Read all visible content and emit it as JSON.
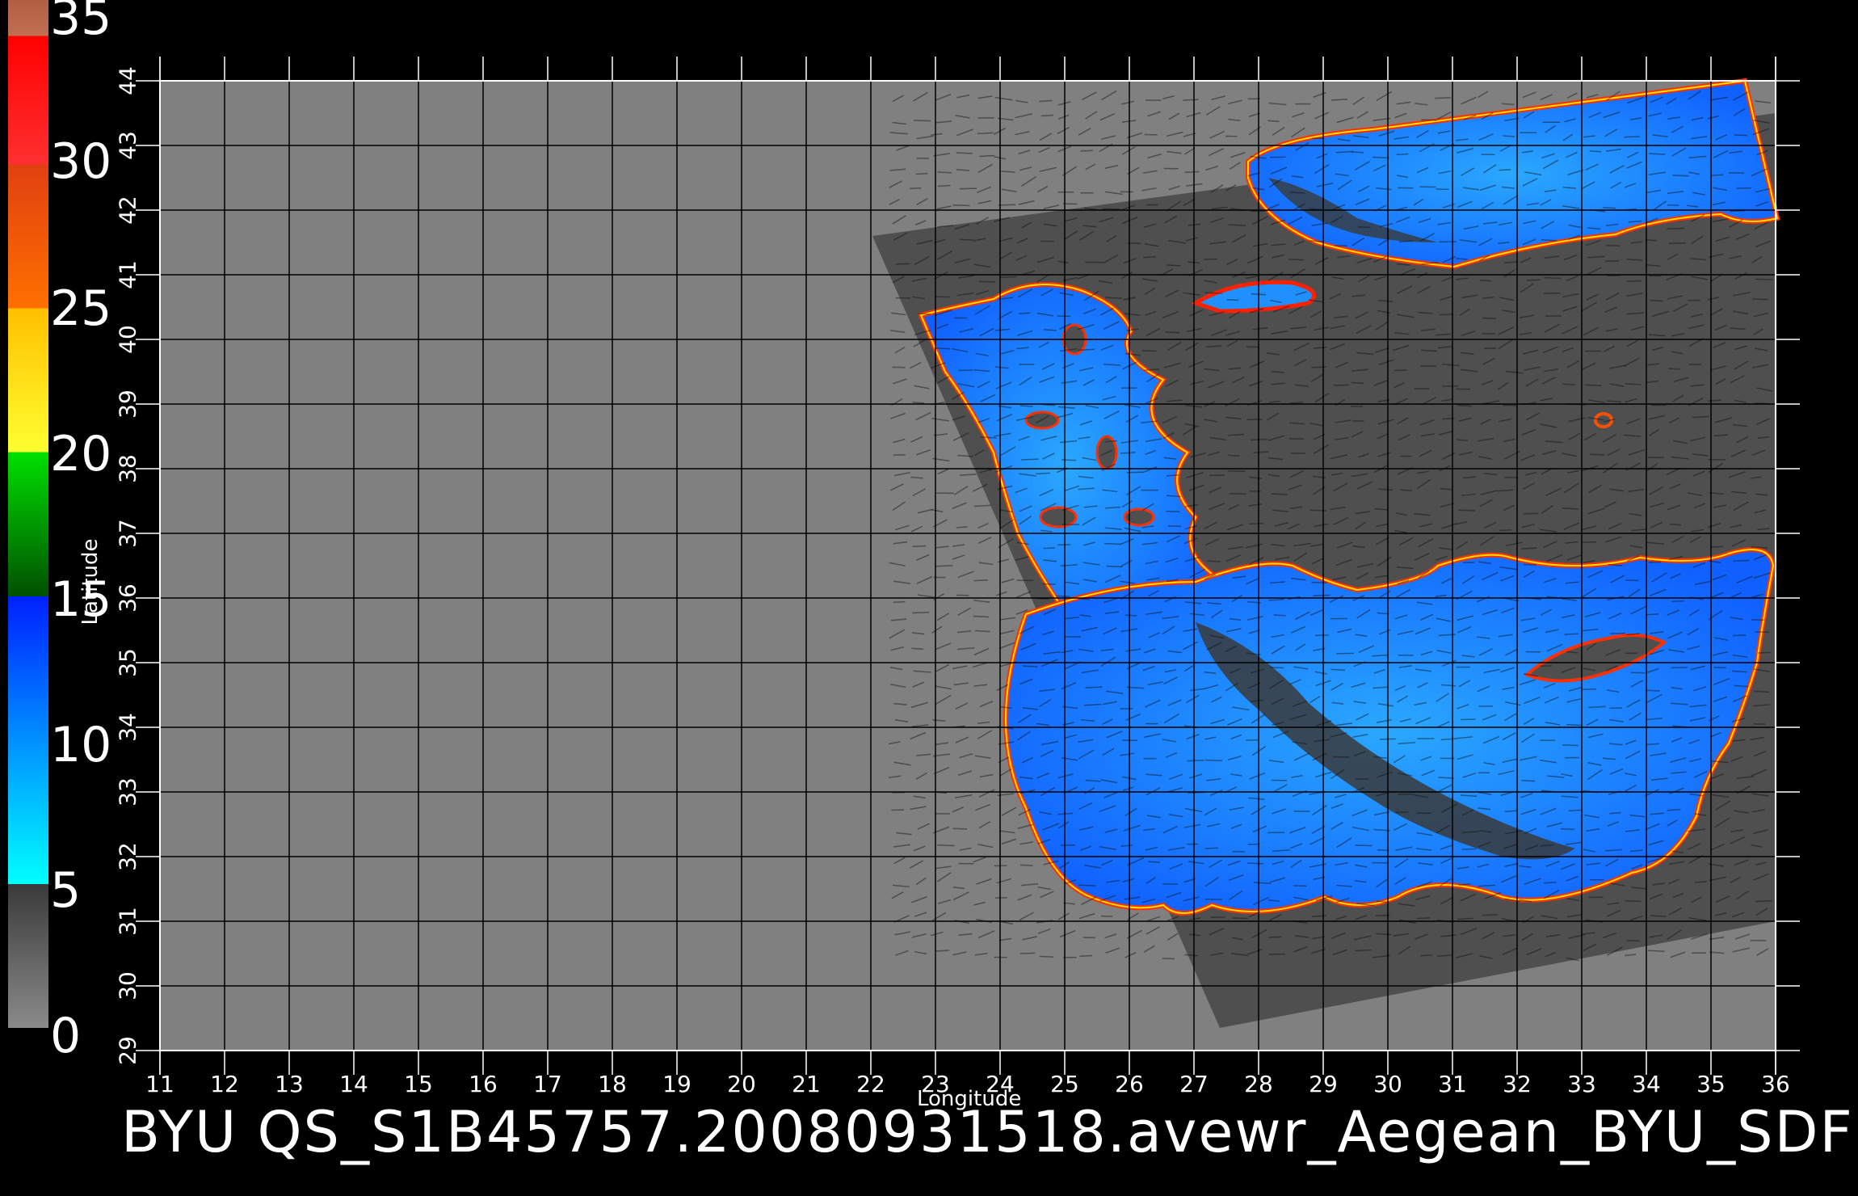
{
  "caption": "BYU  QS_S1B45757.20080931518.avewr_Aegean_BYU_SDF",
  "x_axis_label": "Longitude",
  "y_axis_label": "Latitude",
  "colorbar": {
    "labels": [
      "35",
      "30",
      "25",
      "20",
      "15",
      "10",
      "5",
      "0"
    ],
    "colors": {
      "gray": "#5a5a5a",
      "cyan": "#00ffff",
      "blue": "#0030ff",
      "green": "#00c000",
      "yellow": "#ffff00",
      "orange": "#ff8000",
      "red": "#ff0000",
      "brown": "#c07040"
    }
  },
  "longitudes": [
    "11",
    "12",
    "13",
    "14",
    "15",
    "16",
    "17",
    "18",
    "19",
    "20",
    "21",
    "22",
    "23",
    "24",
    "25",
    "26",
    "27",
    "28",
    "29",
    "30",
    "31",
    "32",
    "33",
    "34",
    "35",
    "36"
  ],
  "latitudes": [
    "29",
    "30",
    "31",
    "32",
    "33",
    "34",
    "35",
    "36",
    "37",
    "38",
    "39",
    "40",
    "41",
    "42",
    "43",
    "44"
  ],
  "colors": {
    "background": "#000000",
    "map_fill": "#808080",
    "swath_fill": "#505050",
    "grid": "#000000",
    "sea_blue": "#1a8cff"
  }
}
